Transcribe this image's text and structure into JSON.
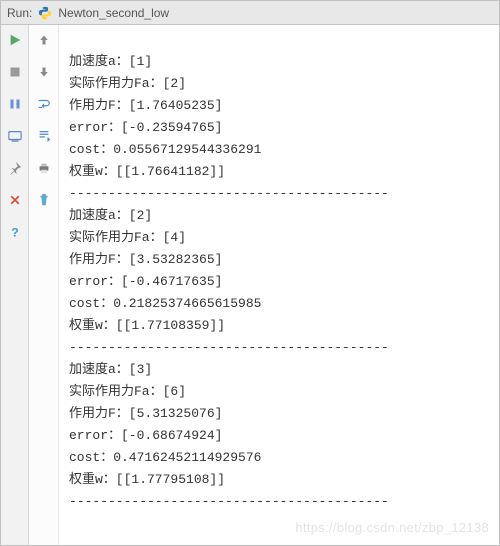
{
  "titlebar": {
    "run_label": "Run:",
    "script_name": "Newton_second_low"
  },
  "console": {
    "blocks": [
      {
        "a": "加速度a：[1]",
        "fa": "实际作用力Fa：[2]",
        "f": "作用力F：[1.76405235]",
        "err": "error：[-0.23594765]",
        "cost": "cost：0.05567129544336291",
        "w": "权重w：[[1.76641182]]"
      },
      {
        "a": "加速度a：[2]",
        "fa": "实际作用力Fa：[4]",
        "f": "作用力F：[3.53282365]",
        "err": "error：[-0.46717635]",
        "cost": "cost：0.21825374665615985",
        "w": "权重w：[[1.77108359]]"
      },
      {
        "a": "加速度a：[3]",
        "fa": "实际作用力Fa：[6]",
        "f": "作用力F：[5.31325076]",
        "err": "error：[-0.68674924]",
        "cost": "cost：0.47162452114929576",
        "w": "权重w：[[1.77795108]]"
      }
    ],
    "separator": "-----------------------------------------"
  },
  "watermark": "https://blog.csdn.net/zbp_12138",
  "icons": {
    "run": "run-icon",
    "stop": "stop-icon",
    "pause": "pause-icon",
    "dump": "dump-icon",
    "pin": "pin-icon",
    "close": "close-icon",
    "help": "help-icon",
    "up": "up-arrow-icon",
    "down": "down-arrow-icon",
    "wrap": "wrap-icon",
    "print": "print-icon",
    "trash": "trash-icon",
    "scroll": "scroll-icon"
  }
}
